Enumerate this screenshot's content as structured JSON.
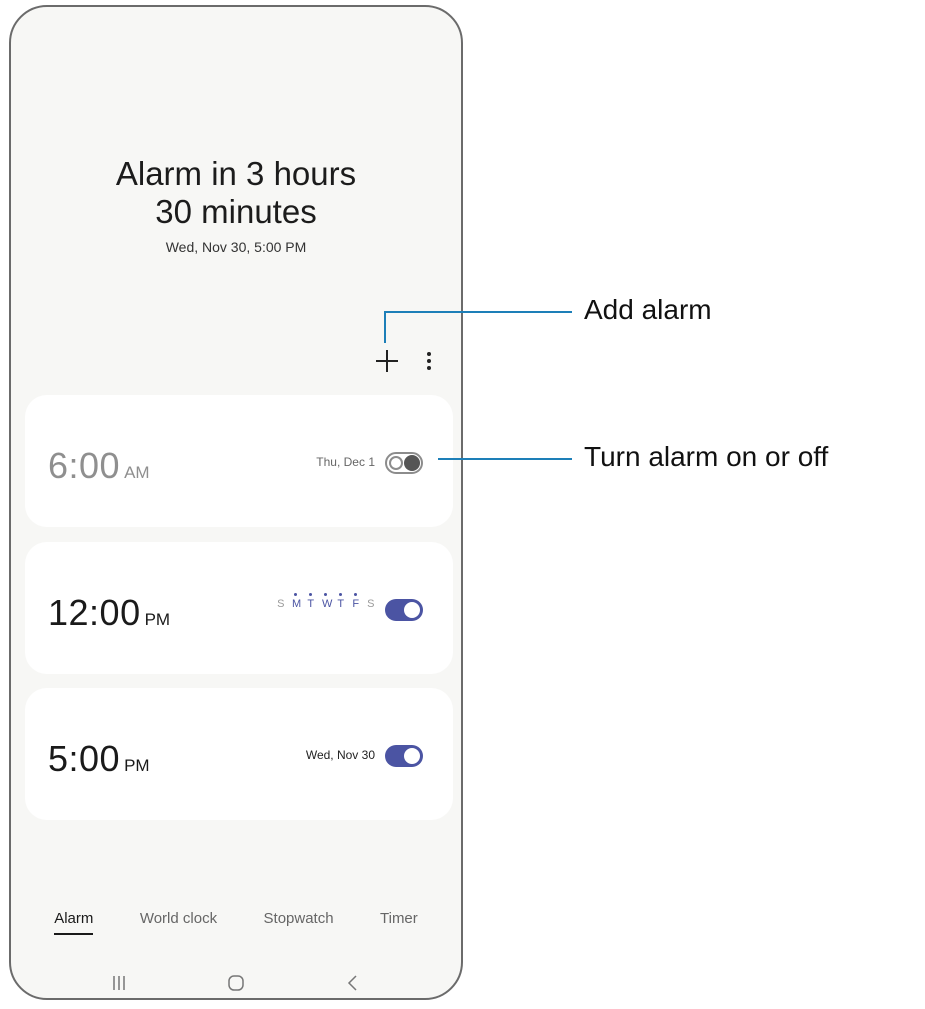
{
  "header": {
    "headline_line1": "Alarm in 3 hours",
    "headline_line2": "30 minutes",
    "next_alarm": "Wed, Nov 30, 5:00 PM"
  },
  "toolbar": {
    "add_icon": "plus-icon",
    "more_icon": "more-options-icon"
  },
  "alarms": [
    {
      "time": "6:00",
      "ampm": "AM",
      "meta": "Thu, Dec 1",
      "enabled": false
    },
    {
      "time": "12:00",
      "ampm": "PM",
      "days": [
        "S",
        "M",
        "T",
        "W",
        "T",
        "F",
        "S"
      ],
      "active_days": [
        false,
        true,
        true,
        true,
        true,
        true,
        false
      ],
      "enabled": true
    },
    {
      "time": "5:00",
      "ampm": "PM",
      "meta": "Wed, Nov 30",
      "enabled": true
    }
  ],
  "tabs": [
    {
      "label": "Alarm",
      "active": true
    },
    {
      "label": "World clock",
      "active": false
    },
    {
      "label": "Stopwatch",
      "active": false
    },
    {
      "label": "Timer",
      "active": false
    }
  ],
  "nav": [
    "recent-apps-icon",
    "home-icon",
    "back-icon"
  ],
  "callouts": {
    "add_alarm": "Add alarm",
    "toggle": "Turn alarm on or off"
  },
  "colors": {
    "accent": "#4b54a3",
    "leader": "#1d7fb8",
    "disabled_text": "#8f8f8f"
  }
}
